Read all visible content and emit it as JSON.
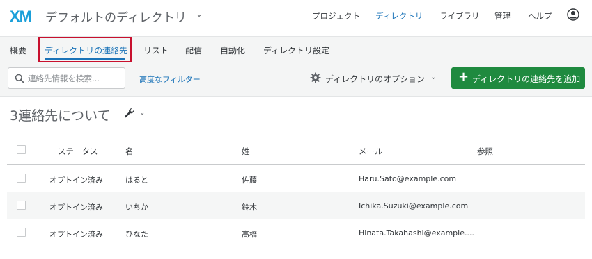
{
  "header": {
    "logo": "XM",
    "directory_title": "デフォルトのディレクトリ",
    "nav": [
      "プロジェクト",
      "ディレクトリ",
      "ライブラリ",
      "管理",
      "ヘルプ"
    ]
  },
  "subnav": {
    "tabs": [
      "概要",
      "ディレクトリの連絡先",
      "リスト",
      "配信",
      "自動化",
      "ディレクトリ設定"
    ],
    "active_tab": "ディレクトリの連絡先"
  },
  "toolbar": {
    "search_placeholder": "連絡先情報を検索...",
    "advanced_filter": "高度なフィルター",
    "directory_options": "ディレクトリのオプション",
    "add_contact": "ディレクトリの連絡先を追加"
  },
  "summary": {
    "count_text": "3連絡先について"
  },
  "table": {
    "headers": [
      "ステータス",
      "名",
      "姓",
      "メール",
      "参照"
    ],
    "rows": [
      {
        "status": "オプトイン済み",
        "first": "はると",
        "last": "佐藤",
        "email": "Haru.Sato@example.com",
        "ref": ""
      },
      {
        "status": "オプトイン済み",
        "first": "いちか",
        "last": "鈴木",
        "email": "Ichika.Suzuki@example.com",
        "ref": ""
      },
      {
        "status": "オプトイン済み",
        "first": "ひなた",
        "last": "高橋",
        "email": "Hinata.Takahashi@example....",
        "ref": ""
      }
    ]
  },
  "colors": {
    "accent": "#1a73b8",
    "brand_logo": "#1a9fd9",
    "primary_button": "#1f8a3f",
    "highlight": "#c8102e"
  }
}
